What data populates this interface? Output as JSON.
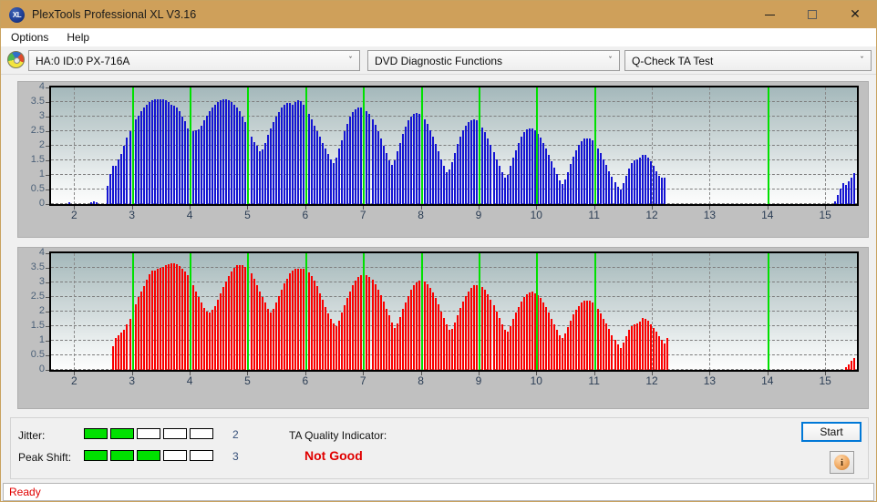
{
  "window": {
    "title": "PlexTools Professional XL V3.16",
    "icon": "xl-app-icon",
    "icon_text": "XL",
    "minimize_label": "–",
    "maximize_label": "□",
    "close_label": "✕",
    "titlebar_color": "#cfa05a"
  },
  "menu": {
    "items": [
      {
        "label": "Options"
      },
      {
        "label": "Help"
      }
    ]
  },
  "toolbar": {
    "disc_icon": "optical-disc-icon",
    "drive_select": {
      "value": "HA:0 ID:0  PX-716A",
      "arrow": "ˇ"
    },
    "function_select": {
      "value": "DVD Diagnostic Functions",
      "arrow": "ˇ"
    },
    "test_select": {
      "value": "Q-Check TA Test",
      "arrow": "ˇ"
    }
  },
  "charts": {
    "y_ticks": [
      "4",
      "3.5",
      "3",
      "2.5",
      "2",
      "1.5",
      "1",
      "0.5",
      "0"
    ],
    "x_ticks": [
      "2",
      "3",
      "4",
      "5",
      "6",
      "7",
      "8",
      "9",
      "10",
      "11",
      "12",
      "13",
      "14",
      "15"
    ],
    "top_color": "#1414d2",
    "bottom_color": "#fa0000",
    "marker_color": "#00e000"
  },
  "chart_data": [
    {
      "type": "bar",
      "title": "Q-Check TA Test - Pit/Land jitter (top)",
      "xlabel": "",
      "ylabel": "",
      "ylim": [
        0,
        4
      ],
      "xlim": [
        1.6,
        15.55
      ],
      "grid": true,
      "series_color": "#1414d2",
      "marker_x": [
        3,
        4,
        5,
        6,
        7,
        8,
        9,
        10,
        11,
        14
      ],
      "x_tick_values": [
        2,
        3,
        4,
        5,
        6,
        7,
        8,
        9,
        10,
        11,
        12,
        13,
        14,
        15
      ],
      "y_tick_values": [
        0,
        0.5,
        1,
        1.5,
        2,
        2.5,
        3,
        3.5,
        4
      ],
      "x_start": 1.9,
      "x_step": 0.0477,
      "values": [
        0.07,
        0,
        0,
        0,
        0,
        0,
        0,
        0,
        0.06,
        0.08,
        0.06,
        0,
        0,
        0,
        0.62,
        1.02,
        1.3,
        1.3,
        1.52,
        1.72,
        2.0,
        2.27,
        2.5,
        2.72,
        2.9,
        3.02,
        3.2,
        3.3,
        3.42,
        3.5,
        3.56,
        3.6,
        3.6,
        3.58,
        3.58,
        3.56,
        3.5,
        3.42,
        3.38,
        3.3,
        3.18,
        3.0,
        2.84,
        2.6,
        2.5,
        2.5,
        2.52,
        2.56,
        2.7,
        2.86,
        3.02,
        3.18,
        3.3,
        3.42,
        3.5,
        3.56,
        3.6,
        3.6,
        3.56,
        3.5,
        3.42,
        3.3,
        3.18,
        3.0,
        2.82,
        2.56,
        2.3,
        2.12,
        2.0,
        1.82,
        1.86,
        2.1,
        2.36,
        2.6,
        2.8,
        3.0,
        3.16,
        3.3,
        3.42,
        3.46,
        3.46,
        3.4,
        3.5,
        3.56,
        3.54,
        3.42,
        3.3,
        3.1,
        2.9,
        2.7,
        2.5,
        2.3,
        2.1,
        1.9,
        1.72,
        1.52,
        1.4,
        1.58,
        1.9,
        2.2,
        2.5,
        2.76,
        3.0,
        3.16,
        3.26,
        3.32,
        3.32,
        3.28,
        3.2,
        3.08,
        2.92,
        2.72,
        2.5,
        2.26,
        2.0,
        1.76,
        1.5,
        1.34,
        1.5,
        1.8,
        2.1,
        2.4,
        2.66,
        2.86,
        3.0,
        3.1,
        3.14,
        3.1,
        3.02,
        2.9,
        2.74,
        2.54,
        2.3,
        2.06,
        1.8,
        1.54,
        1.3,
        1.1,
        1.18,
        1.45,
        1.75,
        2.05,
        2.3,
        2.52,
        2.7,
        2.82,
        2.88,
        2.9,
        2.86,
        2.78,
        2.64,
        2.46,
        2.26,
        2.02,
        1.78,
        1.54,
        1.3,
        1.1,
        0.92,
        1.0,
        1.3,
        1.58,
        1.84,
        2.08,
        2.3,
        2.46,
        2.56,
        2.6,
        2.58,
        2.52,
        2.42,
        2.28,
        2.1,
        1.9,
        1.68,
        1.46,
        1.24,
        1.02,
        0.82,
        0.7,
        0.84,
        1.1,
        1.38,
        1.62,
        1.84,
        2.02,
        2.16,
        2.24,
        2.26,
        2.24,
        2.18,
        2.06,
        1.92,
        1.74,
        1.54,
        1.34,
        1.14,
        0.94,
        0.76,
        0.6,
        0.5,
        0.72,
        0.98,
        1.22,
        1.4,
        1.5,
        1.52,
        1.6,
        1.7,
        1.68,
        1.58,
        1.46,
        1.3,
        1.14,
        0.98,
        0.9,
        0.9,
        0,
        0,
        0,
        0,
        0,
        0,
        0,
        0,
        0,
        0,
        0,
        0,
        0,
        0,
        0,
        0,
        0,
        0,
        0,
        0,
        0,
        0,
        0,
        0,
        0,
        0,
        0,
        0,
        0,
        0,
        0,
        0,
        0,
        0,
        0,
        0,
        0,
        0,
        0,
        0,
        0,
        0,
        0,
        0,
        0,
        0,
        0,
        0,
        0,
        0,
        0,
        0,
        0,
        0,
        0,
        0,
        0,
        0,
        0,
        0,
        0,
        0.1,
        0.3,
        0.52,
        0.72,
        0.66,
        0.78,
        0.9,
        1.06,
        1.22,
        1.38,
        1.52,
        1.66,
        1.76,
        1.84,
        1.9,
        1.92,
        1.9,
        1.84,
        1.76,
        1.62,
        1.46,
        1.3,
        1.1,
        0.9,
        0.7,
        0.52,
        0.36,
        0.22,
        0.12,
        0.2,
        0,
        0,
        0,
        0,
        0,
        0,
        0,
        0,
        0,
        0,
        0,
        0,
        0,
        0,
        0,
        0,
        0,
        0,
        0,
        0,
        0,
        0,
        0,
        0,
        0,
        0,
        0.12,
        0,
        0,
        0
      ]
    },
    {
      "type": "bar",
      "title": "Q-Check TA Test - Pit/Land jitter (bottom)",
      "xlabel": "",
      "ylabel": "",
      "ylim": [
        0,
        4
      ],
      "xlim": [
        1.6,
        15.55
      ],
      "grid": true,
      "series_color": "#fa0000",
      "marker_x": [
        3,
        4,
        5,
        6,
        7,
        8,
        9,
        10,
        11,
        14
      ],
      "x_tick_values": [
        2,
        3,
        4,
        5,
        6,
        7,
        8,
        9,
        10,
        11,
        12,
        13,
        14,
        15
      ],
      "y_tick_values": [
        0,
        0.5,
        1,
        1.5,
        2,
        2.5,
        3,
        3.5,
        4
      ],
      "x_start": 1.9,
      "x_step": 0.0477,
      "values": [
        0,
        0,
        0,
        0,
        0,
        0,
        0,
        0,
        0,
        0,
        0,
        0,
        0,
        0,
        0,
        0,
        0.8,
        1.1,
        1.2,
        1.28,
        1.36,
        1.56,
        1.76,
        2.0,
        2.26,
        2.5,
        2.7,
        2.88,
        3.08,
        3.28,
        3.42,
        3.42,
        3.48,
        3.5,
        3.54,
        3.58,
        3.62,
        3.66,
        3.66,
        3.62,
        3.56,
        3.48,
        3.38,
        3.24,
        3.08,
        2.9,
        2.7,
        2.5,
        2.3,
        2.14,
        2.0,
        1.98,
        2.06,
        2.2,
        2.4,
        2.62,
        2.84,
        3.04,
        3.22,
        3.38,
        3.5,
        3.58,
        3.6,
        3.58,
        3.52,
        3.42,
        3.3,
        3.12,
        2.92,
        2.7,
        2.5,
        2.3,
        2.1,
        1.96,
        2.1,
        2.3,
        2.52,
        2.74,
        2.96,
        3.14,
        3.3,
        3.4,
        3.46,
        3.48,
        3.46,
        3.46,
        3.42,
        3.34,
        3.22,
        3.06,
        2.86,
        2.64,
        2.4,
        2.16,
        1.94,
        1.74,
        1.58,
        1.5,
        1.7,
        1.96,
        2.22,
        2.48,
        2.7,
        2.9,
        3.06,
        3.18,
        3.24,
        3.26,
        3.24,
        3.18,
        3.08,
        2.94,
        2.76,
        2.56,
        2.34,
        2.1,
        1.86,
        1.62,
        1.44,
        1.58,
        1.82,
        2.08,
        2.32,
        2.54,
        2.74,
        2.9,
        3.0,
        3.06,
        3.06,
        3.02,
        2.94,
        2.82,
        2.66,
        2.46,
        2.24,
        2.0,
        1.78,
        1.56,
        1.36,
        1.42,
        1.64,
        1.88,
        2.12,
        2.34,
        2.54,
        2.7,
        2.82,
        2.9,
        2.92,
        2.9,
        2.84,
        2.74,
        2.6,
        2.42,
        2.22,
        2.0,
        1.78,
        1.56,
        1.36,
        1.3,
        1.5,
        1.74,
        1.96,
        2.16,
        2.34,
        2.5,
        2.6,
        2.66,
        2.68,
        2.64,
        2.56,
        2.46,
        2.32,
        2.16,
        1.96,
        1.76,
        1.56,
        1.36,
        1.18,
        1.08,
        1.26,
        1.48,
        1.7,
        1.9,
        2.06,
        2.2,
        2.3,
        2.36,
        2.38,
        2.36,
        2.3,
        2.2,
        2.08,
        1.94,
        1.76,
        1.58,
        1.4,
        1.2,
        1.02,
        0.86,
        0.76,
        0.94,
        1.16,
        1.36,
        1.5,
        1.56,
        1.6,
        1.66,
        1.78,
        1.76,
        1.68,
        1.56,
        1.44,
        1.3,
        1.16,
        1.02,
        0.9,
        1.1,
        0,
        0,
        0,
        0,
        0,
        0,
        0,
        0,
        0,
        0,
        0,
        0,
        0,
        0,
        0,
        0,
        0,
        0,
        0,
        0,
        0,
        0,
        0,
        0,
        0,
        0,
        0,
        0,
        0,
        0,
        0,
        0,
        0,
        0,
        0,
        0,
        0,
        0,
        0,
        0,
        0,
        0,
        0,
        0,
        0,
        0,
        0,
        0,
        0,
        0,
        0,
        0,
        0,
        0,
        0,
        0,
        0,
        0,
        0,
        0,
        0,
        0,
        0,
        0,
        0.1,
        0.2,
        0.32,
        0.42,
        0.5,
        0.6,
        0.72,
        0.86,
        1.0,
        1.12,
        1.2,
        1.22,
        1.16,
        1.06,
        0.94,
        0.8,
        0.66,
        0.52,
        0.4,
        0.28,
        0.18,
        0.1,
        0.06,
        0,
        0,
        0,
        0,
        0,
        0,
        0,
        0,
        0,
        0,
        0,
        0,
        0,
        0,
        0,
        0,
        0,
        0,
        0,
        0,
        0,
        0,
        0,
        0,
        0,
        0,
        0,
        0,
        0,
        0,
        0,
        0,
        0
      ]
    }
  ],
  "results": {
    "jitter": {
      "label": "Jitter:",
      "value": "2",
      "filled": 2,
      "total": 5
    },
    "peak_shift": {
      "label": "Peak Shift:",
      "value": "3",
      "filled": 3,
      "total": 5
    },
    "ta_quality": {
      "label": "TA Quality Indicator:",
      "value": "Not Good",
      "value_color": "#e00000"
    },
    "start_button": "Start",
    "info_button": "i"
  },
  "statusbar": {
    "text": "Ready"
  }
}
